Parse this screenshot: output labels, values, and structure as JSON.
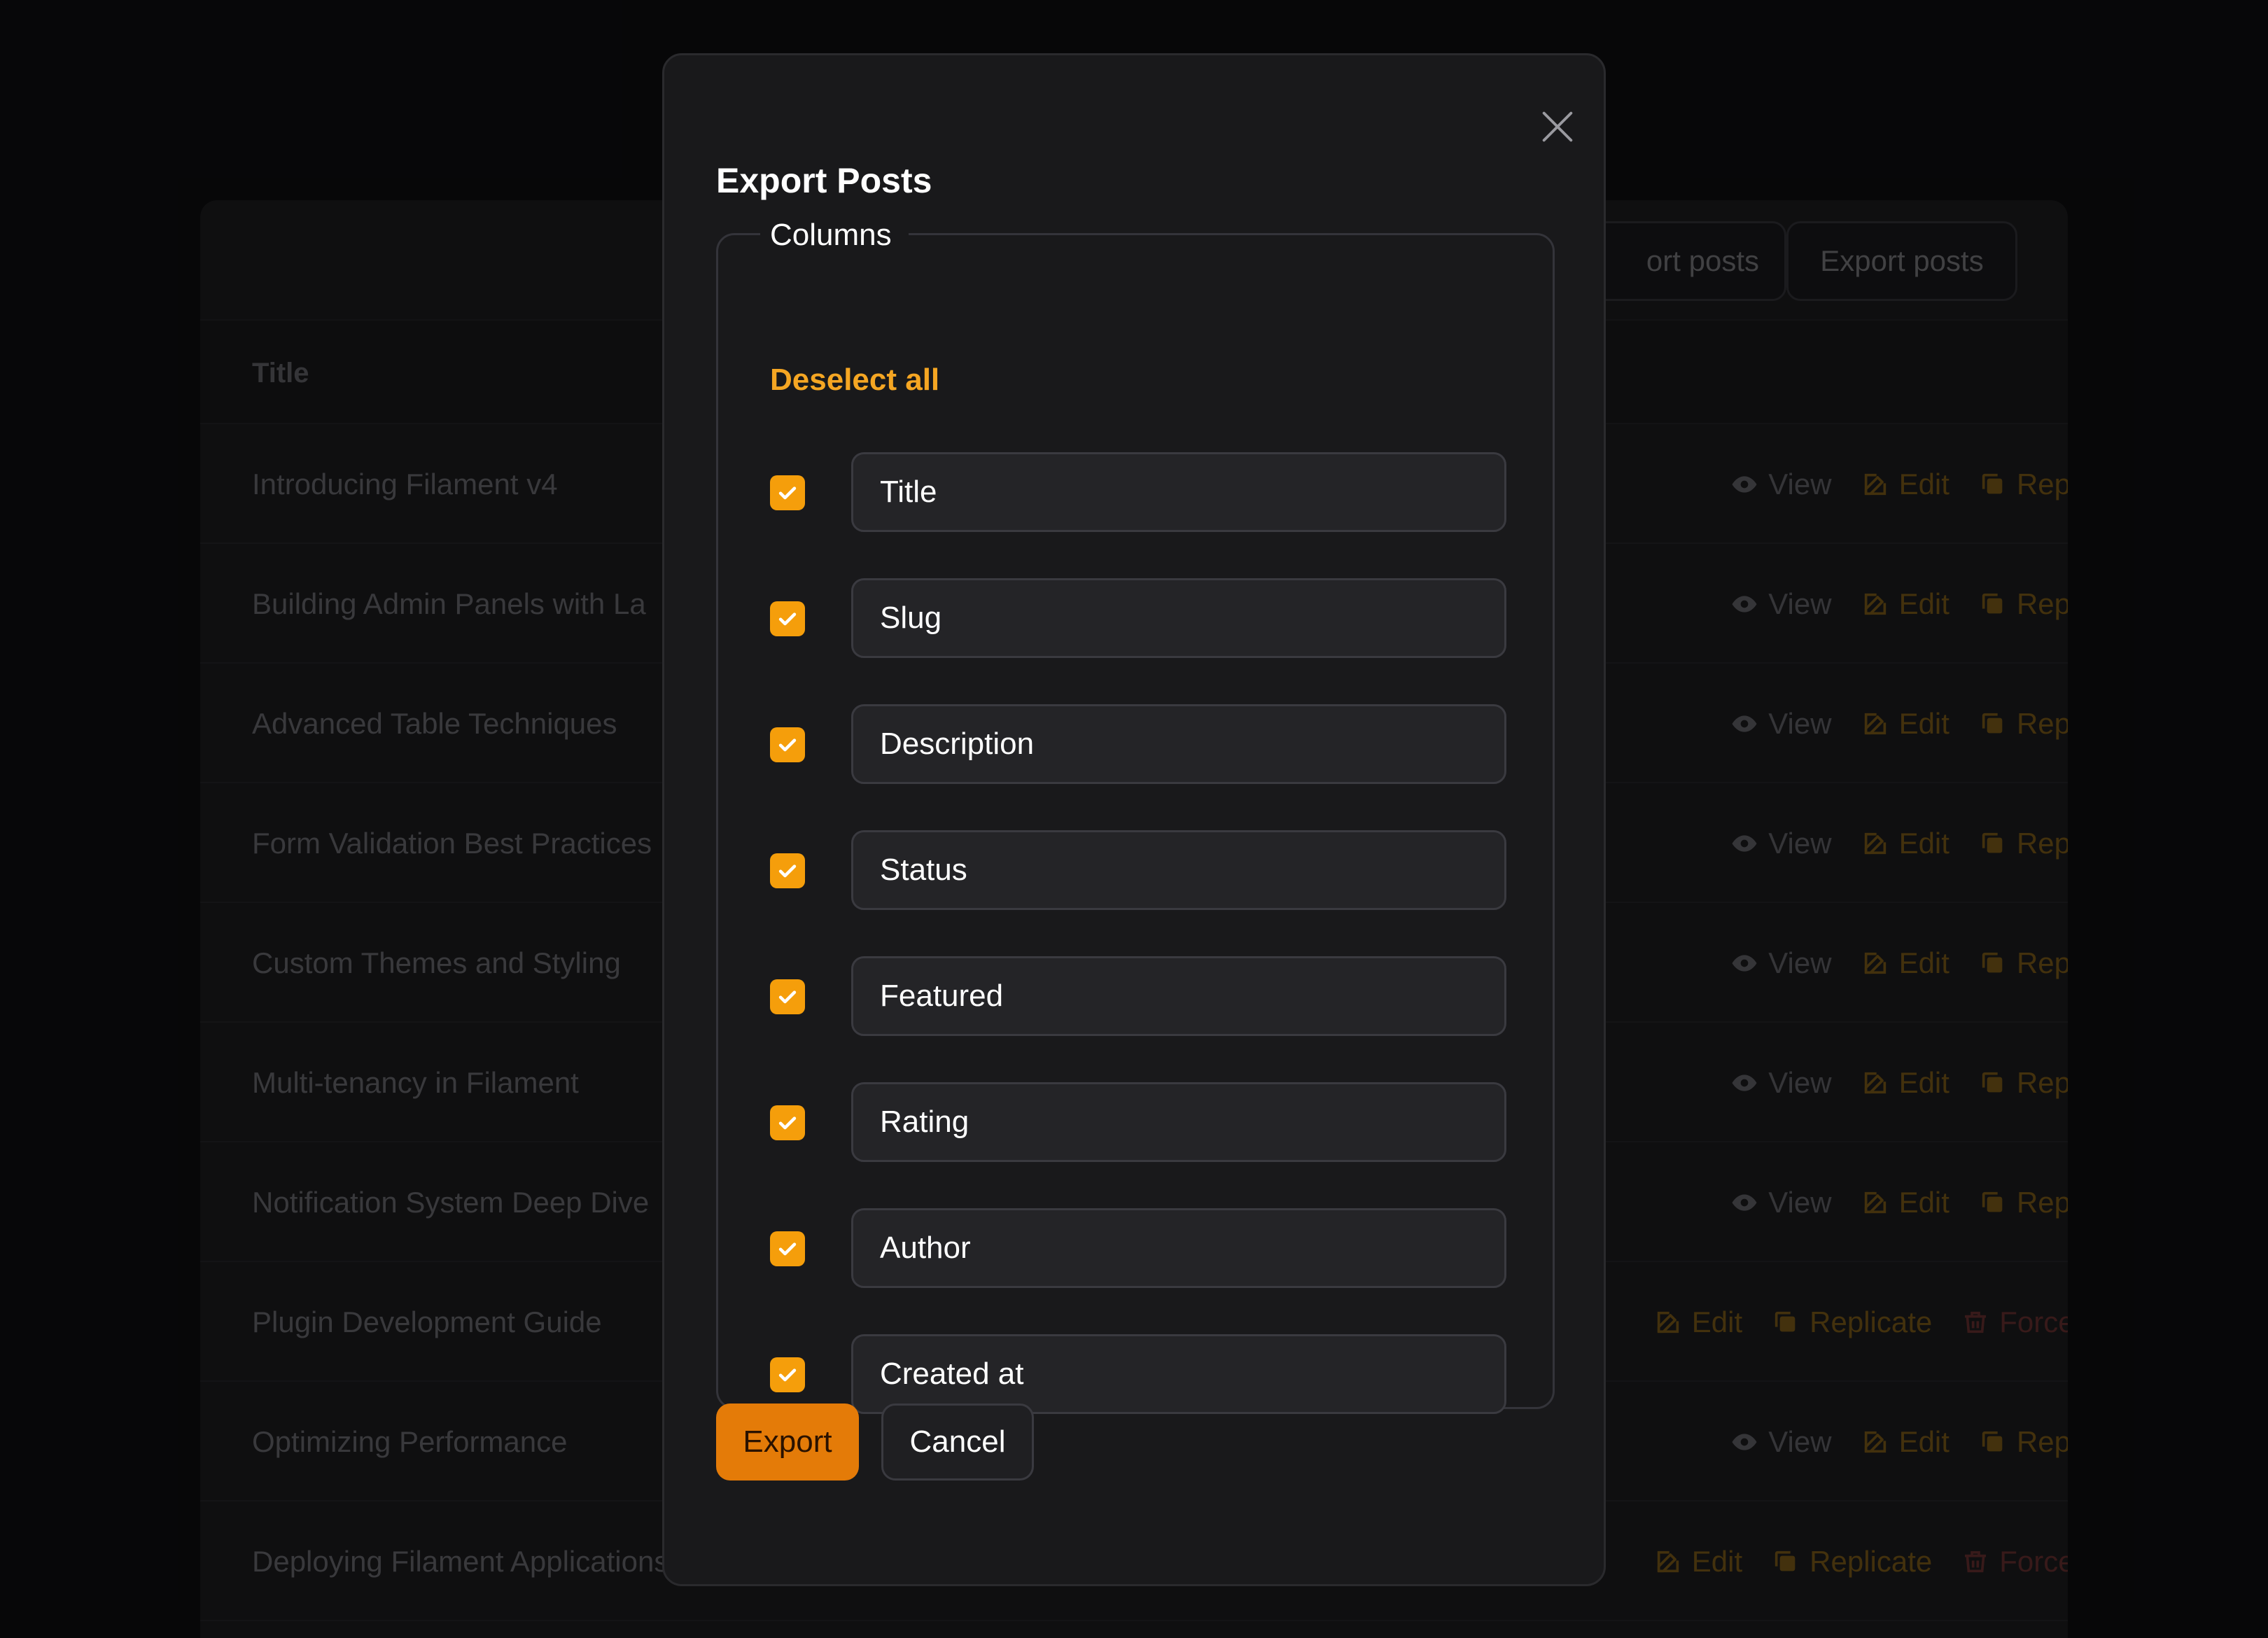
{
  "modal": {
    "title": "Export Posts",
    "columns_legend": "Columns",
    "deselect_all": "Deselect all",
    "columns": [
      {
        "label": "Title",
        "checked": true
      },
      {
        "label": "Slug",
        "checked": true
      },
      {
        "label": "Description",
        "checked": true
      },
      {
        "label": "Status",
        "checked": true
      },
      {
        "label": "Featured",
        "checked": true
      },
      {
        "label": "Rating",
        "checked": true
      },
      {
        "label": "Author",
        "checked": true
      },
      {
        "label": "Created at",
        "checked": true
      }
    ],
    "export_label": "Export",
    "cancel_label": "Cancel"
  },
  "background": {
    "import_label": "Import posts",
    "import_visible": "ort posts",
    "export_label": "Export posts",
    "title_header": "Title",
    "rows": [
      {
        "title": "Introducing Filament v4",
        "actions": "view-edit"
      },
      {
        "title": "Building Admin Panels with La",
        "actions": "view-edit"
      },
      {
        "title": "Advanced Table Techniques",
        "actions": "view-edit"
      },
      {
        "title": "Form Validation Best Practices",
        "actions": "view-edit"
      },
      {
        "title": "Custom Themes and Styling",
        "actions": "view-edit"
      },
      {
        "title": "Multi-tenancy in Filament",
        "actions": "view-edit"
      },
      {
        "title": "Notification System Deep Dive",
        "actions": "view-edit"
      },
      {
        "title": "Plugin Development Guide",
        "actions": "trashed"
      },
      {
        "title": "Optimizing Performance",
        "actions": "view-edit"
      },
      {
        "title": "Deploying Filament Applications",
        "actions": "trashed"
      }
    ],
    "action_labels": {
      "view": "View",
      "edit": "Edit",
      "replicate_short": "Rep",
      "replicate": "Replicate",
      "force_short": "Force de"
    }
  },
  "colors": {
    "accent": "#f59e0b",
    "primary_button": "#e47b08",
    "modal_bg": "#19191b"
  }
}
